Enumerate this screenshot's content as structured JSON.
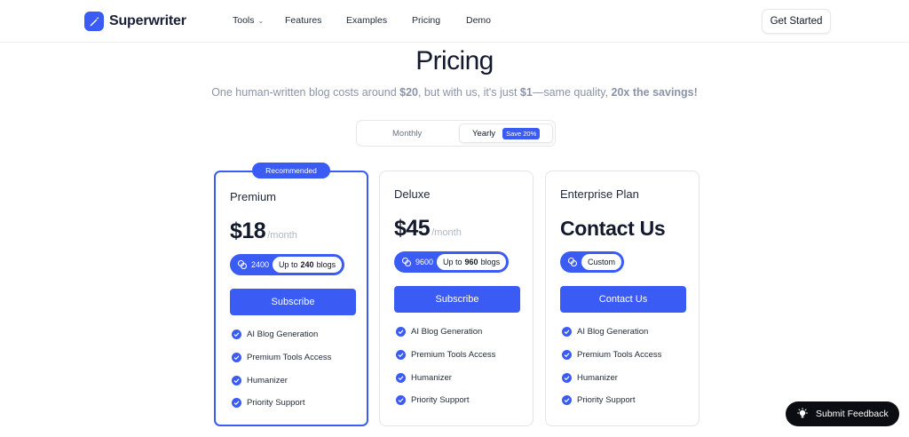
{
  "brand": {
    "name": "Superwriter",
    "accent": "#3a5cf5"
  },
  "nav": {
    "tools": "Tools",
    "features": "Features",
    "examples": "Examples",
    "pricing": "Pricing",
    "demo": "Demo",
    "cta": "Get Started"
  },
  "hero": {
    "title": "Pricing",
    "subtitle_pre": "One human-written blog costs around ",
    "subtitle_cost": "$20",
    "subtitle_mid": ", but with us, it's just ",
    "subtitle_price": "$1",
    "subtitle_post": "—same quality, ",
    "subtitle_savings": "20x the savings!"
  },
  "billing_toggle": {
    "monthly": "Monthly",
    "yearly": "Yearly",
    "badge": "Save 20%",
    "selected": "Yearly"
  },
  "plans": [
    {
      "name": "Premium",
      "badge": "Recommended",
      "price": "$18",
      "period": "/month",
      "credits": "2400",
      "blogs_pre": "Up to",
      "blogs_count": "240",
      "blogs_post": "blogs",
      "button": "Subscribe",
      "features": [
        "AI Blog Generation",
        "Premium Tools Access",
        "Humanizer",
        "Priority Support"
      ]
    },
    {
      "name": "Deluxe",
      "price": "$45",
      "period": "/month",
      "credits": "9600",
      "blogs_pre": "Up to",
      "blogs_count": "960",
      "blogs_post": "blogs",
      "button": "Subscribe",
      "features": [
        "AI Blog Generation",
        "Premium Tools Access",
        "Humanizer",
        "Priority Support"
      ]
    },
    {
      "name": "Enterprise Plan",
      "price": "Contact Us",
      "credits": "Custom",
      "button": "Contact Us",
      "features": [
        "AI Blog Generation",
        "Premium Tools Access",
        "Humanizer",
        "Priority Support"
      ]
    }
  ],
  "feedback": {
    "label": "Submit Feedback"
  },
  "icons": {
    "logo": "pen-icon",
    "coin": "coins-icon",
    "check": "check-circle-icon",
    "feedback": "lightbulb-icon",
    "dropdown": "chevron-down-icon"
  }
}
